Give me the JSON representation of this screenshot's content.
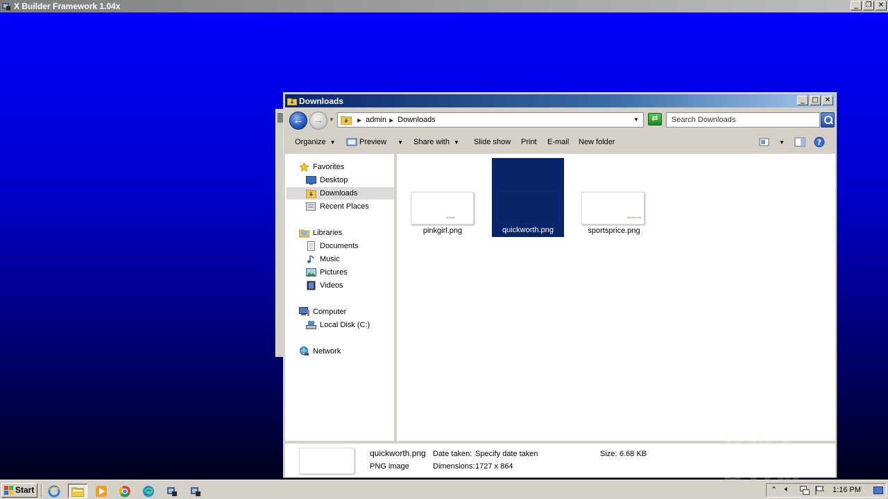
{
  "app": {
    "title": "X Builder Framework 1.04x"
  },
  "window": {
    "title": "Downloads"
  },
  "address": {
    "crumbs": [
      "admin",
      "Downloads"
    ],
    "search_placeholder": "Search Downloads"
  },
  "toolbar": {
    "organize": "Organize",
    "preview": "Preview",
    "share_with": "Share with",
    "slide_show": "Slide show",
    "print": "Print",
    "email": "E-mail",
    "new_folder": "New folder"
  },
  "nav": {
    "favorites": "Favorites",
    "desktop": "Desktop",
    "downloads": "Downloads",
    "recent_places": "Recent Places",
    "libraries": "Libraries",
    "documents": "Documents",
    "music": "Music",
    "pictures": "Pictures",
    "videos": "Videos",
    "computer": "Computer",
    "local_disk": "Local Disk (C:)",
    "network": "Network"
  },
  "files": [
    {
      "name": "pinkgirl.png",
      "thumb_text": "pinkgirl"
    },
    {
      "name": "quickworth.png",
      "thumb_text": "",
      "selected": true
    },
    {
      "name": "sportsprice.png",
      "thumb_text": "sportsprice"
    }
  ],
  "details": {
    "name": "quickworth.png",
    "type": "PNG image",
    "date_taken_label": "Date taken:",
    "date_taken_value": "Specify date taken",
    "dimensions_label": "Dimensions:",
    "dimensions_value": "1727 x 864",
    "size_label": "Size:",
    "size_value": "6.68 KB"
  },
  "taskbar": {
    "start": "Start",
    "clock": "1:16 PM"
  },
  "watermark": "ANY RUN",
  "colors": {
    "desktop_top": "#0000ff",
    "selection": "#0a246a",
    "titlebar_active": "#0a246a"
  }
}
